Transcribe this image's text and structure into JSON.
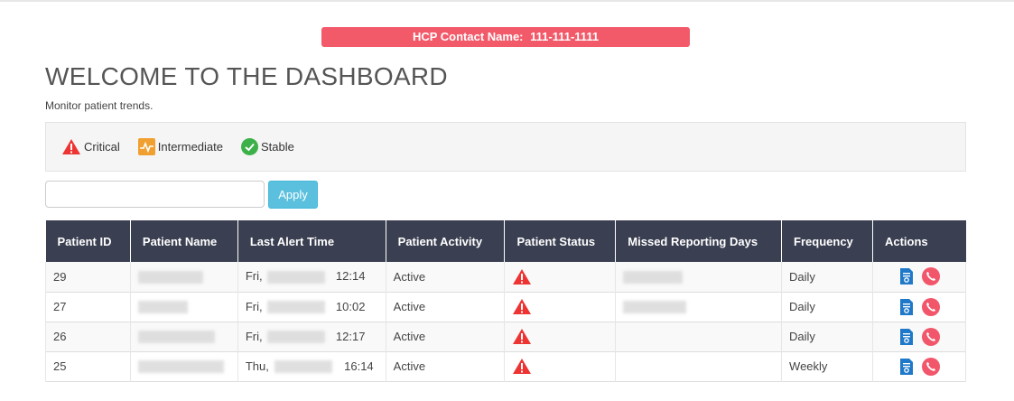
{
  "hcp": {
    "label": "HCP Contact Name:",
    "value": "111-111-1111"
  },
  "header": {
    "title": "WELCOME TO THE DASHBOARD",
    "subtitle": "Monitor patient trends."
  },
  "legend": {
    "critical": "Critical",
    "intermediate": "Intermediate",
    "stable": "Stable"
  },
  "search": {
    "value": "",
    "apply_label": "Apply"
  },
  "table": {
    "columns": [
      "Patient ID",
      "Patient Name",
      "Last Alert Time",
      "Patient Activity",
      "Patient Status",
      "Missed Reporting Days",
      "Frequency",
      "Actions"
    ],
    "rows": [
      {
        "id": "29",
        "day": "Fri,",
        "time": "12:14",
        "activity": "Active",
        "frequency": "Daily"
      },
      {
        "id": "27",
        "day": "Fri,",
        "time": "10:02",
        "activity": "Active",
        "frequency": "Daily"
      },
      {
        "id": "26",
        "day": "Fri,",
        "time": "12:17",
        "activity": "Active",
        "frequency": "Daily"
      },
      {
        "id": "25",
        "day": "Thu,",
        "time": "16:14",
        "activity": "Active",
        "frequency": "Weekly"
      }
    ]
  },
  "colors": {
    "critical": "#ee3333",
    "intermediate": "#f0a030",
    "stable": "#3cb14a",
    "header_bg": "#3a3f51",
    "hcp_bg": "#f25a6a",
    "doc_icon": "#1f78c8",
    "phone_icon": "#f2566a"
  }
}
